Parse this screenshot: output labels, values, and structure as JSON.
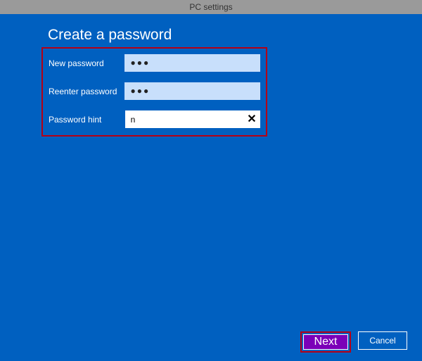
{
  "window": {
    "title": "PC settings"
  },
  "heading": "Create a password",
  "form": {
    "new_password": {
      "label": "New password",
      "masked_value": "●●●"
    },
    "reenter_password": {
      "label": "Reenter password",
      "masked_value": "●●●"
    },
    "password_hint": {
      "label": "Password hint",
      "value": "n"
    }
  },
  "buttons": {
    "next": "Next",
    "cancel": "Cancel"
  },
  "icons": {
    "clear": "✕"
  }
}
